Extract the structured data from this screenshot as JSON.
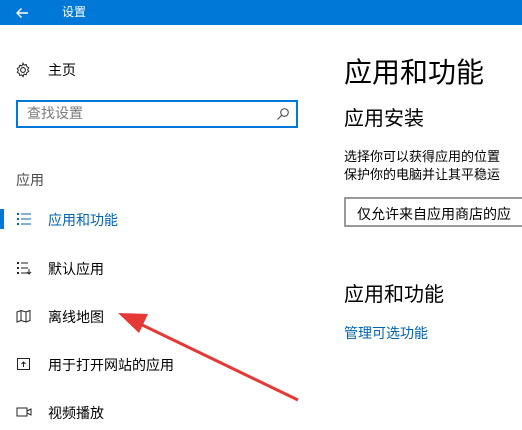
{
  "window": {
    "title": "设置"
  },
  "sidebar": {
    "home_label": "主页",
    "search_placeholder": "查找设置",
    "section_label": "应用",
    "items": [
      {
        "label": "应用和功能",
        "icon": "apps-features-icon",
        "active": true
      },
      {
        "label": "默认应用",
        "icon": "default-apps-icon",
        "active": false
      },
      {
        "label": "离线地图",
        "icon": "offline-maps-icon",
        "active": false
      },
      {
        "label": "用于打开网站的应用",
        "icon": "apps-for-websites-icon",
        "active": false
      },
      {
        "label": "视频播放",
        "icon": "video-playback-icon",
        "active": false
      }
    ]
  },
  "main": {
    "title": "应用和功能",
    "install_heading": "应用安装",
    "install_desc_line1": "选择你可以获得应用的位置",
    "install_desc_line2": "保护你的电脑并让其平稳运",
    "install_dropdown_value": "仅允许来自应用商店的应",
    "features_heading": "应用和功能",
    "optional_features_link": "管理可选功能"
  },
  "colors": {
    "accent": "#0078d7",
    "link": "#0063b1",
    "annotation_arrow": "#e53935"
  }
}
